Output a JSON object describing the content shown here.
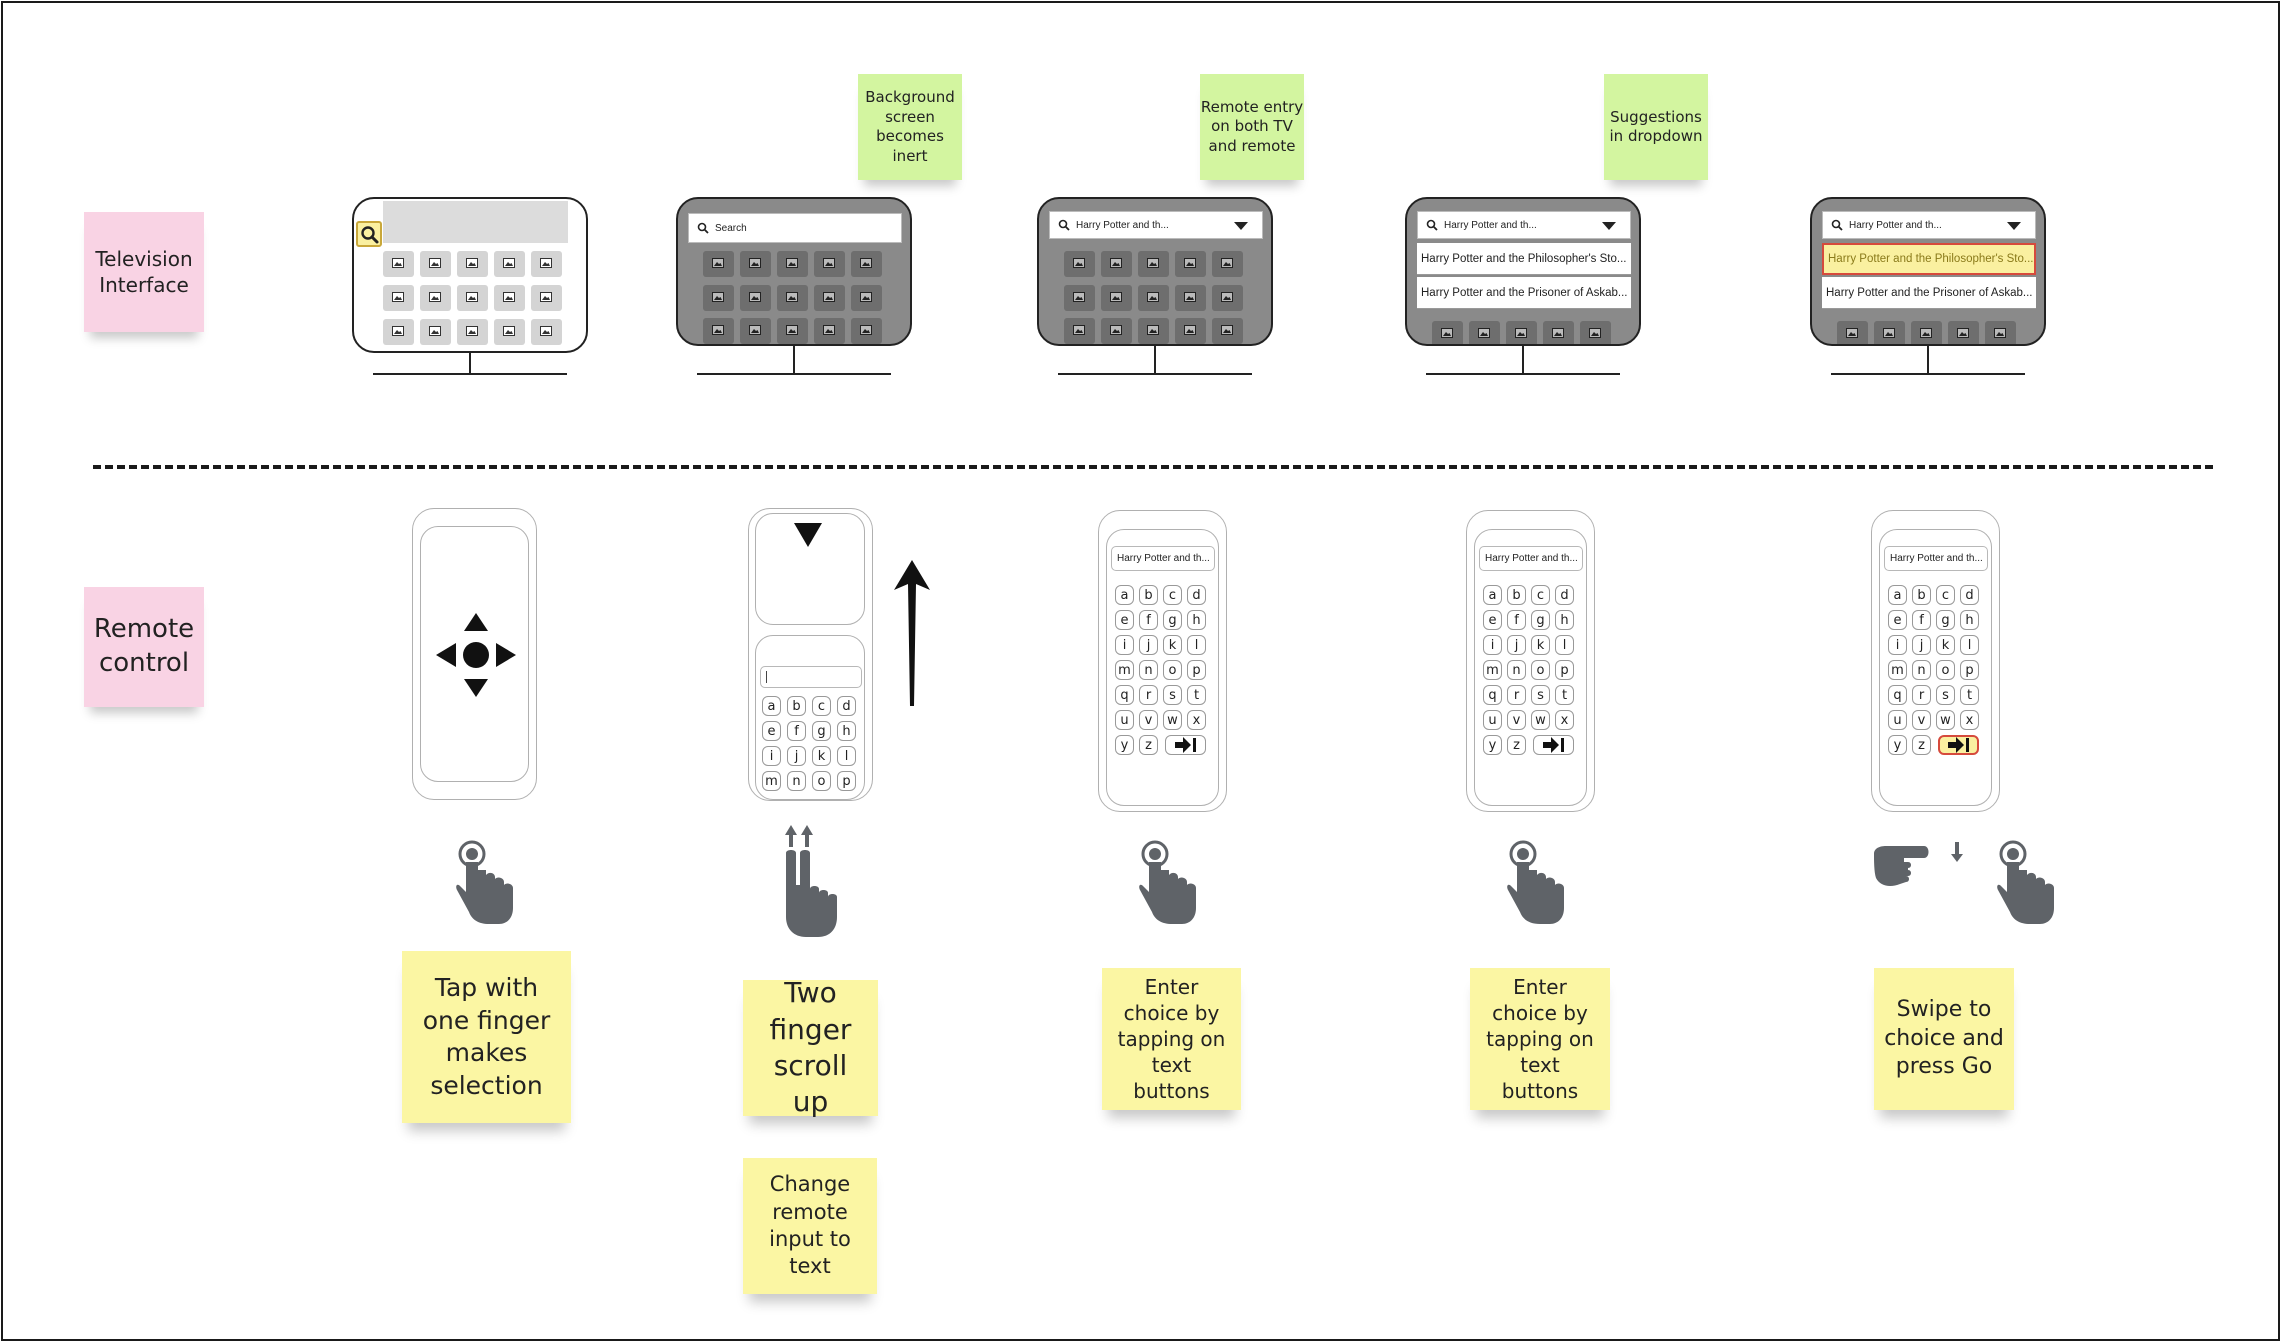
{
  "labels": {
    "tv_interface": "Television Interface",
    "remote_control": "Remote control"
  },
  "notes": {
    "background_inert": "Background screen becomes inert",
    "remote_entry": "Remote entry on both TV and remote",
    "suggestions": "Suggestions in dropdown",
    "tap_one_finger": "Tap with one finger makes selection",
    "two_finger_scroll": "Two finger scroll up",
    "change_input": "Change remote input to text",
    "enter_choice_1": "Enter choice by tapping on text buttons",
    "enter_choice_2": "Enter choice by tapping on text buttons",
    "swipe_go": "Swipe to choice and press Go"
  },
  "tv": {
    "search_placeholder": "Search",
    "query": "Harry Potter and th...",
    "suggestion_1": "Harry Potter and the Philosopher's Sto...",
    "suggestion_2": "Harry Potter and the Prisoner of Askab..."
  },
  "remote": {
    "query": "Harry Potter and th...",
    "keys_full": [
      "a",
      "b",
      "c",
      "d",
      "e",
      "f",
      "g",
      "h",
      "i",
      "j",
      "k",
      "l",
      "m",
      "n",
      "o",
      "p",
      "q",
      "r",
      "s",
      "t",
      "u",
      "v",
      "w",
      "x",
      "y",
      "z"
    ],
    "keys_partial": [
      "a",
      "b",
      "c",
      "d",
      "e",
      "f",
      "g",
      "h",
      "i",
      "j",
      "k",
      "l",
      "m",
      "n",
      "o",
      "p"
    ]
  },
  "colors": {
    "pink_note": "#f9d3e4",
    "green_note": "#d3f5a0",
    "yellow_note": "#fbf6a3",
    "highlight_fill": "#faf0a0",
    "highlight_border": "#d64a3c",
    "screen_dim": "#8a8a8a",
    "icon_grey": "#5f6368"
  },
  "icons": [
    "search-icon",
    "image-icon",
    "chevron-down-icon",
    "dpad-icon",
    "chevron-down-arrow-icon",
    "scroll-up-arrow-icon",
    "go-enter-icon",
    "one-finger-tap-icon",
    "two-finger-scroll-icon",
    "swipe-hand-icon"
  ]
}
